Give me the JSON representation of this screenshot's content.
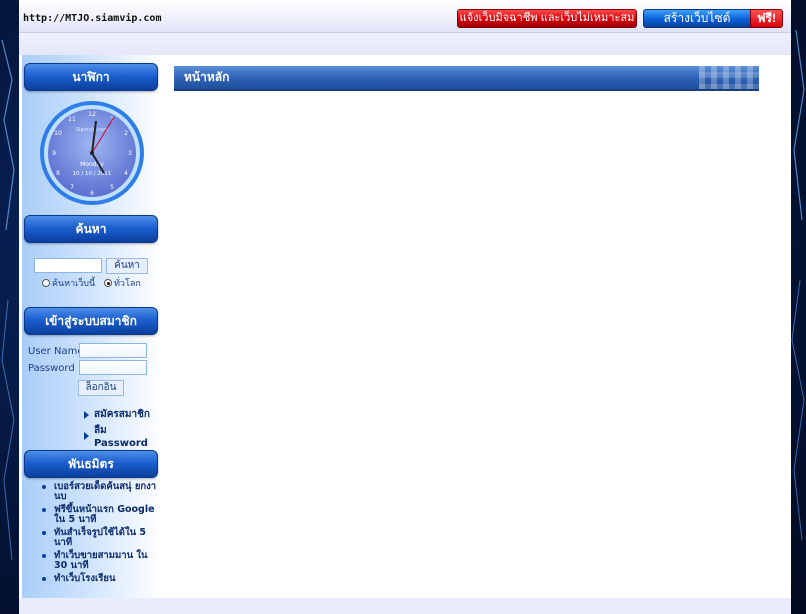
{
  "header": {
    "url": "http://MTJO.siamvip.com",
    "ad_red": "แจ้งเว็บมิจฉาชีพ และเว็บไม่เหมาะสม",
    "ad_blue": "สร้างเว็บไซต์",
    "ad_free": "ฟรี!"
  },
  "sidebar": {
    "clock_title": "นาฬิกา",
    "clock_day": "Monday",
    "clock_date": "10 / 10 / 2011",
    "clock_brand": "Siamvip.com",
    "search_title": "ค้นหา",
    "search_input": "",
    "search_button": "ค้นหา",
    "radio_site": "ค้นหาเว็บนี้",
    "radio_world": "ทั่วโลก",
    "login_title": "เข้าสู่ระบบสมาชิก",
    "username_label": "User Name",
    "password_label": "Password",
    "username_value": "",
    "password_value": "",
    "login_button": "ล็อกอิน",
    "register_link": "สมัครสมาชิก",
    "forgot_link": "ลืม Password",
    "partners_title": "พันธมิตร",
    "partners": [
      "เบอร์สวยเด็ดค้นสนุ่ ยกงานบ",
      "ฟรีขึ้นหน้าแรก Google ใน 5 นาที",
      "ทันสำเร็จรูปใช้ได้ใน 5 นาที",
      "ทำเว็บขายสามมาน ใน 30 นาที",
      "ทำเว็บโรงเรียน"
    ]
  },
  "main": {
    "title": "หน้าหลัก"
  },
  "colors": {
    "accent": "#1c5fd0",
    "page_bg": "#061a45",
    "ad_red": "#d4000a",
    "ad_blue": "#0b5fd6"
  }
}
